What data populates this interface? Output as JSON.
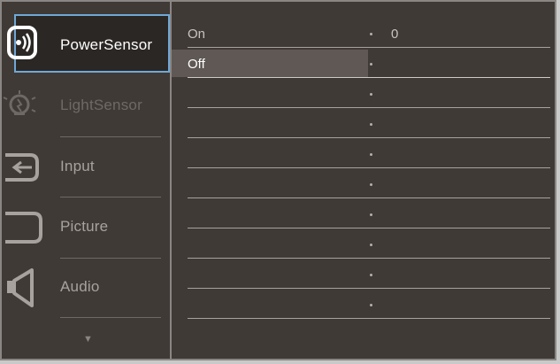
{
  "sidebar": {
    "items": [
      {
        "label": "PowerSensor",
        "icon": "power-sensor-icon",
        "state": "active"
      },
      {
        "label": "LightSensor",
        "icon": "light-sensor-icon",
        "state": "muted"
      },
      {
        "label": "Input",
        "icon": "input-icon",
        "state": "normal"
      },
      {
        "label": "Picture",
        "icon": "picture-icon",
        "state": "normal"
      },
      {
        "label": "Audio",
        "icon": "audio-icon",
        "state": "normal"
      }
    ],
    "scroll_indicator": "▼"
  },
  "options": {
    "items": [
      {
        "label": "On",
        "value": "0"
      },
      {
        "label": "Off",
        "value": ""
      }
    ],
    "selected": "Off"
  },
  "colors": {
    "background": "#3f3a36",
    "active_border": "#6fa8d6",
    "highlight": "#5f5854"
  }
}
